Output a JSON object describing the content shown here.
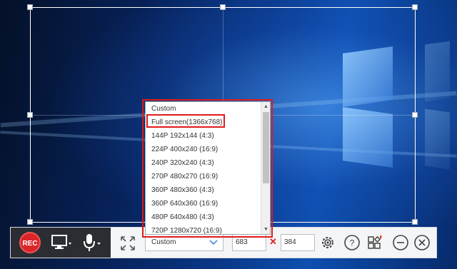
{
  "toolbar": {
    "rec_label": "REC",
    "size_select_value": "Custom",
    "width_value": "683",
    "height_value": "384",
    "times_sign": "✕"
  },
  "dropdown": {
    "items": [
      "Custom",
      "Full screen(1366x768)",
      "144P 192x144 (4:3)",
      "224P 400x240 (16:9)",
      "240P 320x240 (4:3)",
      "270P 480x270 (16:9)",
      "360P 480x360 (4:3)",
      "360P 640x360 (16:9)",
      "480P 640x480 (4:3)",
      "720P 1280x720 (16:9)"
    ]
  },
  "colors": {
    "rec": "#d9262a",
    "highlight_frame": "#e01b1b",
    "toolbar_dark": "#2b2d33",
    "toolbar_light": "#f4f5f7"
  },
  "icons": [
    "screen-icon",
    "microphone-icon",
    "fit-to-screen-icon",
    "chevron-down-icon",
    "settings-gear-icon",
    "help-icon",
    "toolbox-icon",
    "minimize-icon",
    "close-icon"
  ]
}
